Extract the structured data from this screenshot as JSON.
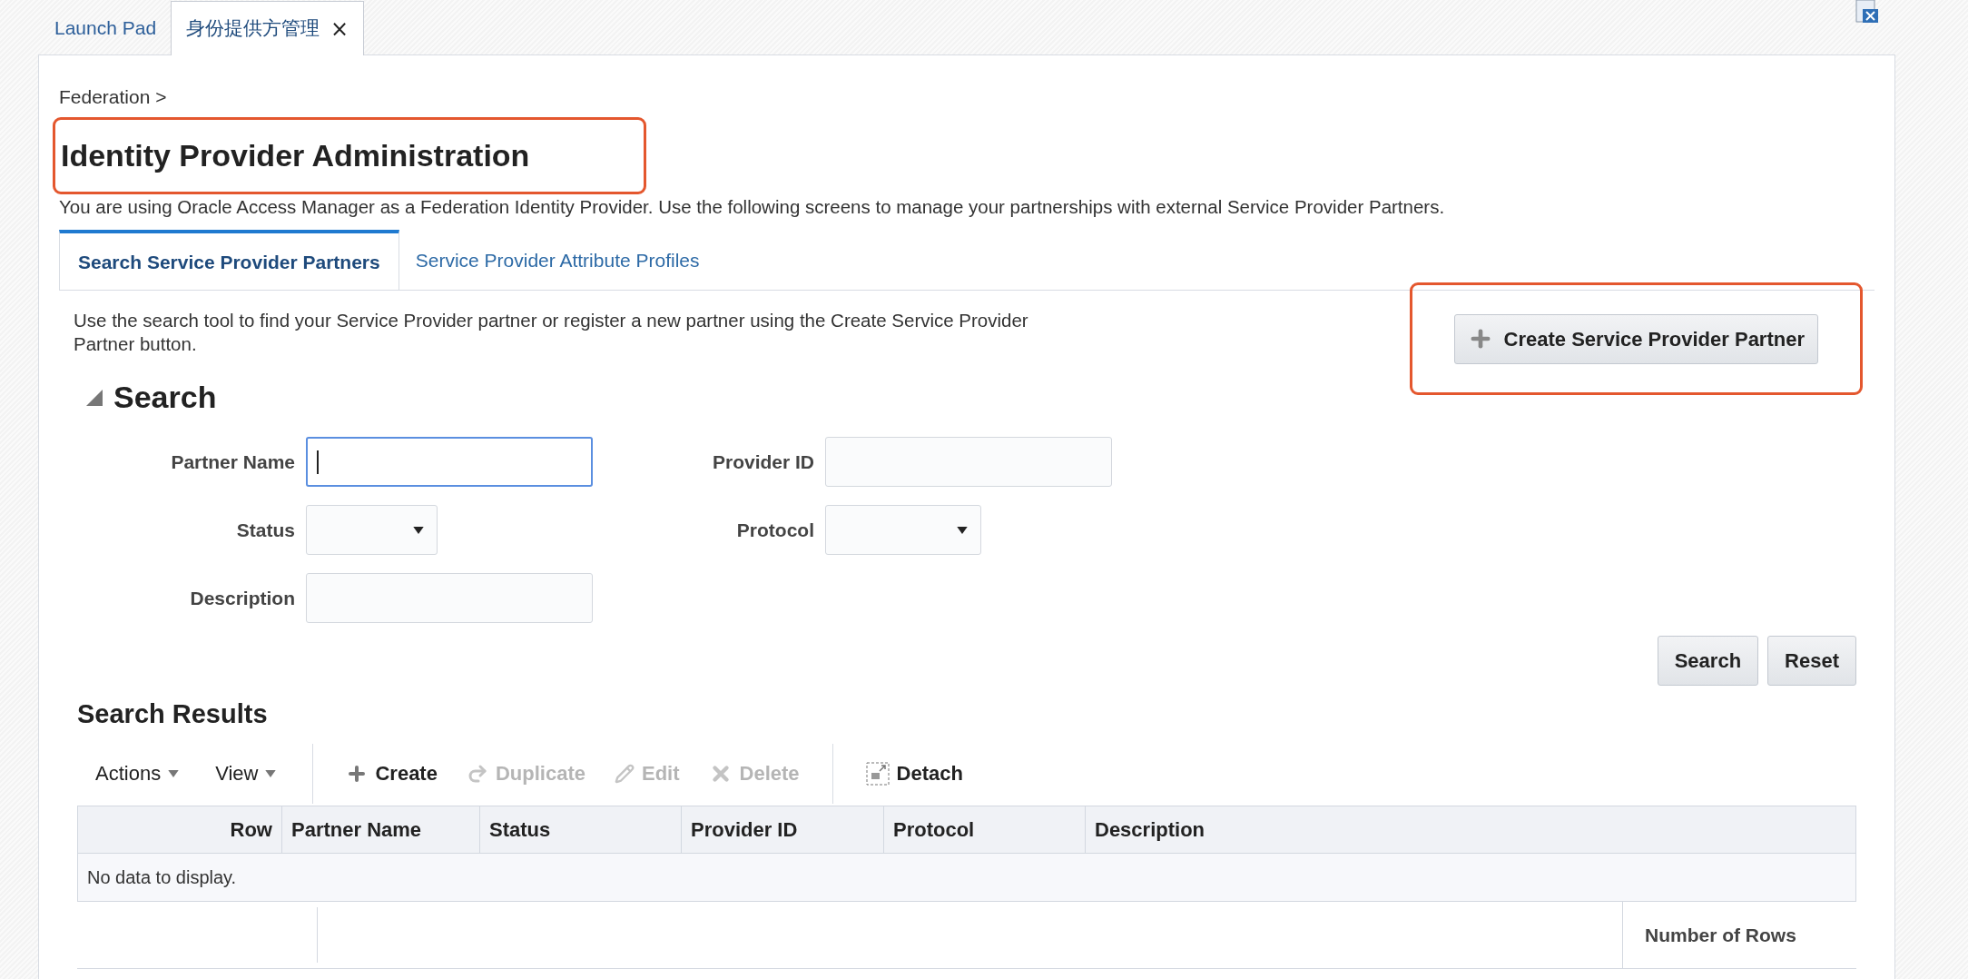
{
  "tabs": [
    {
      "label": "Launch Pad",
      "selected": false
    },
    {
      "label": "身份提供方管理",
      "selected": true,
      "close_label": "×"
    }
  ],
  "breadcrumb": "Federation >",
  "title": {
    "text": "Identity Provider Administration",
    "highlighted": true
  },
  "description": "You are using Oracle Access Manager as a Federation Identity Provider. Use the following screens to manage your partnerships with external Service Provider Partners.",
  "subtabs": [
    {
      "label": "Search Service Provider Partners",
      "selected": true
    },
    {
      "label": "Service Provider Attribute Profiles",
      "selected": false
    }
  ],
  "instructions": "Use the search tool to find your Service Provider partner or register a new partner using the Create Service Provider Partner button.",
  "create_button": {
    "label": "Create Service Provider Partner",
    "highlighted": true
  },
  "search": {
    "title": "Search",
    "expanded": true,
    "fields": [
      {
        "label": "Partner Name",
        "kind": "text",
        "focused": true
      },
      {
        "label": "Provider ID",
        "kind": "text",
        "focused": false
      },
      {
        "label": "Status",
        "kind": "select",
        "focused": false
      },
      {
        "label": "Protocol",
        "kind": "select",
        "focused": false
      },
      {
        "label": "Description",
        "kind": "text",
        "focused": false
      }
    ],
    "buttons": [
      "Search",
      "Reset"
    ]
  },
  "results": {
    "title": "Search Results",
    "toolbar": [
      {
        "label": "Actions",
        "kind": "menu",
        "disabled": false
      },
      {
        "label": "View",
        "kind": "menu",
        "disabled": false
      },
      {
        "label": "Create",
        "kind": "create",
        "disabled": false
      },
      {
        "label": "Duplicate",
        "kind": "duplicate",
        "disabled": true
      },
      {
        "label": "Edit",
        "kind": "edit",
        "disabled": true
      },
      {
        "label": "Delete",
        "kind": "delete",
        "disabled": true
      },
      {
        "label": "Detach",
        "kind": "detach",
        "disabled": false
      }
    ],
    "columns": [
      "Row",
      "Partner Name",
      "Status",
      "Provider ID",
      "Protocol",
      "Description"
    ],
    "empty_text": "No data to display.",
    "footer_label": "Number of Rows"
  }
}
